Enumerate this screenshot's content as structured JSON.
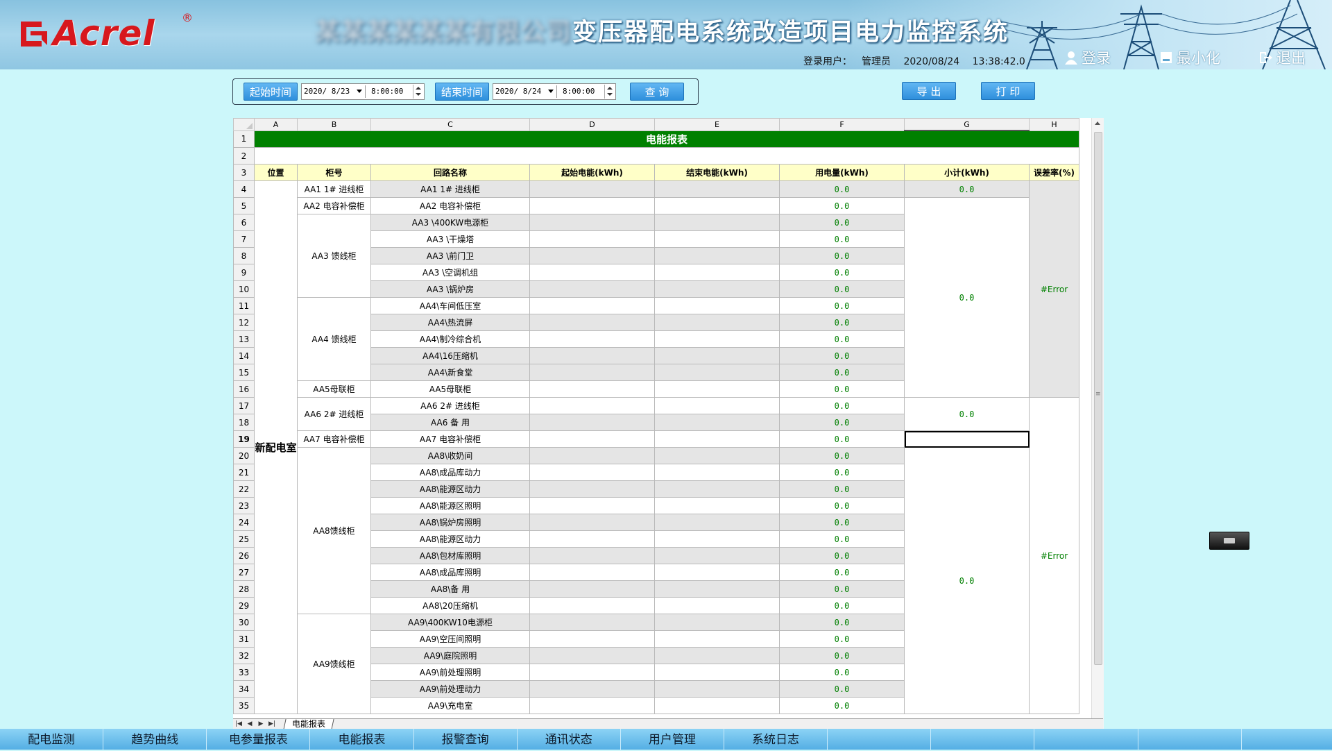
{
  "header": {
    "logo": "Acrel",
    "title_obscured": "某某某某某某有限公司",
    "title": "变压器配电系统改造项目电力监控系统",
    "user_label": "登录用户：",
    "user_name": "管理员",
    "date": "2020/08/24",
    "time": "13:38:42.0",
    "login": "登录",
    "minimize": "最小化",
    "logout": "退出"
  },
  "query": {
    "start_label": "起始时间",
    "start_date": "2020/ 8/23",
    "start_time": "8:00:00",
    "end_label": "结束时间",
    "end_date": "2020/ 8/24",
    "end_time": "8:00:00",
    "query_btn": "查 询",
    "export_btn": "导 出",
    "print_btn": "打 印"
  },
  "sheet": {
    "columns": [
      "A",
      "B",
      "C",
      "D",
      "E",
      "F",
      "G",
      "H"
    ],
    "title": "电能报表",
    "headers": [
      "位置",
      "柜号",
      "回路名称",
      "起始电能(kWh)",
      "结束电能(kWh)",
      "用电量(kWh)",
      "小计(kWh)",
      "误差率(%)"
    ],
    "location": "新配电室",
    "cabinets": {
      "aa1": "AA1 1# 进线柜",
      "aa2": "AA2 电容补偿柜",
      "aa3": "AA3 馈线柜",
      "aa4": "AA4 馈线柜",
      "aa5": "AA5母联柜",
      "aa6": "AA6 2# 进线柜",
      "aa7": "AA7 电容补偿柜",
      "aa8": "AA8馈线柜",
      "aa9": "AA9馈线柜"
    },
    "circuits": [
      "AA1 1# 进线柜",
      "AA2 电容补偿柜",
      "AA3 \\400KW电源柜",
      "AA3 \\干燥塔",
      "AA3 \\前门卫",
      "AA3 \\空调机组",
      "AA3 \\锅炉房",
      "AA4\\车间低压室",
      "AA4\\热流屏",
      "AA4\\制冷综合机",
      "AA4\\16压缩机",
      "AA4\\新食堂",
      "AA5母联柜",
      "AA6 2# 进线柜",
      "AA6  备 用",
      "AA7 电容补偿柜",
      "AA8\\收奶间",
      "AA8\\成品库动力",
      "AA8\\能源区动力",
      "AA8\\能源区照明",
      "AA8\\锅炉房照明",
      "AA8\\能源区动力",
      "AA8\\包材库照明",
      "AA8\\成品库照明",
      "AA8\\备 用",
      "AA8\\20压缩机",
      "AA9\\400KW10电源柜",
      "AA9\\空压间照明",
      "AA9\\庭院照明",
      "AA9\\前处理照明",
      "AA9\\前处理动力",
      "AA9\\充电室"
    ],
    "usage_value": "0.0",
    "subtotals": {
      "g4": "0.0",
      "g5": "0.0",
      "g17": "0.0",
      "g20": "0.0"
    },
    "errors": {
      "h4": "#Error",
      "h17": "#Error"
    },
    "selected_row": "19",
    "tab_name": "电能报表"
  },
  "nav": [
    "配电监测",
    "趋势曲线",
    "电参量报表",
    "电能报表",
    "报警查询",
    "通讯状态",
    "用户管理",
    "系统日志"
  ],
  "colors": {
    "title_green": "#008000",
    "header_yellow": "#ffffc8",
    "value_green": "#008000"
  }
}
